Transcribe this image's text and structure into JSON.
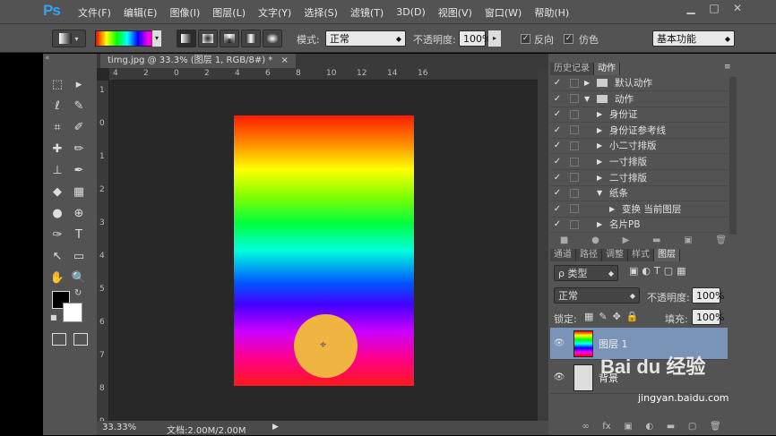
{
  "app": {
    "logo": "Ps"
  },
  "menu": [
    "文件(F)",
    "编辑(E)",
    "图像(I)",
    "图层(L)",
    "文字(Y)",
    "选择(S)",
    "滤镜(T)",
    "3D(D)",
    "视图(V)",
    "窗口(W)",
    "帮助(H)"
  ],
  "window_controls": [
    "▁",
    "□",
    "✕"
  ],
  "options": {
    "mode_label": "模式:",
    "mode_value": "正常",
    "opacity_label": "不透明度:",
    "opacity_value": "100%",
    "reverse_label": "反向",
    "dither_label": "仿色",
    "workspace": "基本功能"
  },
  "document": {
    "tab_title": "timg.jpg @ 33.3% (图层 1, RGB/8#) *",
    "close": "×",
    "zoom": "33.33%",
    "doc_info": "文档:2.00M/2.00M",
    "ruler_h": [
      "4",
      "2",
      "0",
      "2",
      "4",
      "6",
      "8",
      "10",
      "12",
      "14",
      "16"
    ],
    "ruler_v": [
      "1",
      "0",
      "1",
      "2",
      "3",
      "4",
      "5",
      "6",
      "7",
      "8",
      "9"
    ]
  },
  "tools": [
    [
      "⬚",
      "▸"
    ],
    [
      "ℓ",
      "✎"
    ],
    [
      "⌗",
      "✐"
    ],
    [
      "✚",
      "✏"
    ],
    [
      "⊥",
      "✒"
    ],
    [
      "◆",
      "▦"
    ],
    [
      "●",
      "⊕"
    ],
    [
      "✑",
      "T"
    ],
    [
      "↖",
      "▭"
    ],
    [
      "✋",
      "🔍"
    ]
  ],
  "actions_panel": {
    "tabs": [
      "历史记录",
      "动作"
    ],
    "rows": [
      {
        "indent": 0,
        "arrow": "▶",
        "label": "默认动作",
        "folder": true
      },
      {
        "indent": 0,
        "arrow": "▼",
        "label": "动作",
        "folder": true
      },
      {
        "indent": 1,
        "arrow": "▶",
        "label": "身份证"
      },
      {
        "indent": 1,
        "arrow": "▶",
        "label": "身份证参考线"
      },
      {
        "indent": 1,
        "arrow": "▶",
        "label": "小二寸排版"
      },
      {
        "indent": 1,
        "arrow": "▶",
        "label": "一寸排版"
      },
      {
        "indent": 1,
        "arrow": "▶",
        "label": "二寸排版"
      },
      {
        "indent": 1,
        "arrow": "▼",
        "label": "纸条"
      },
      {
        "indent": 2,
        "arrow": "▶",
        "label": "变换 当前图层"
      },
      {
        "indent": 1,
        "arrow": "▶",
        "label": "名片PB"
      }
    ]
  },
  "layers_panel": {
    "tabs": [
      "通道",
      "路径",
      "调整",
      "样式",
      "图层"
    ],
    "filter_label": "ρ 类型",
    "blend_mode": "正常",
    "opacity_label": "不透明度:",
    "opacity_value": "100%",
    "lock_label": "锁定:",
    "fill_label": "填充:",
    "fill_value": "100%",
    "layers": [
      {
        "name": "图层 1",
        "selected": true
      },
      {
        "name": "背景",
        "selected": false
      }
    ]
  },
  "watermark": {
    "brand": "Bai du 经验",
    "url": "jingyan.baidu.com"
  },
  "colors": {
    "accent": "#2fa3f5",
    "panel_bg": "#535353",
    "selected_layer": "#7a93b8"
  }
}
